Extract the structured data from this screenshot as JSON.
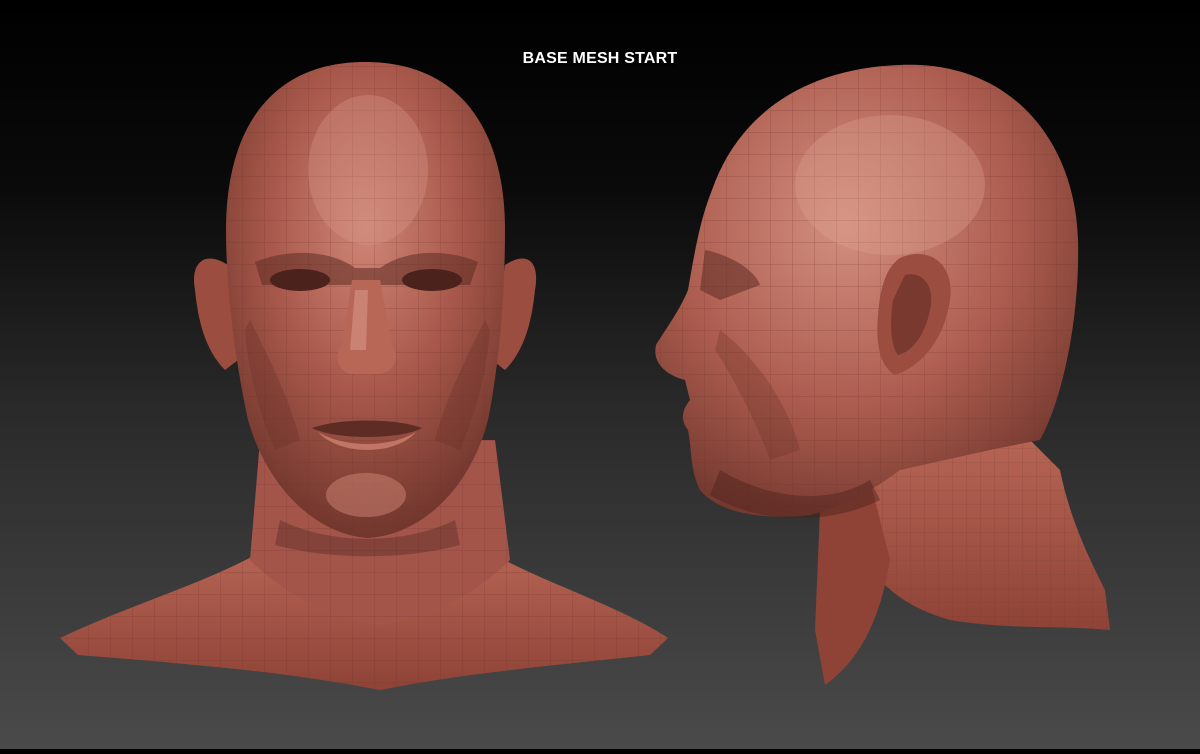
{
  "title": "BASE MESH START",
  "views": [
    {
      "name": "front-view"
    },
    {
      "name": "side-view"
    }
  ],
  "colors": {
    "skin_base": "#a8584a",
    "skin_light": "#d0897a",
    "skin_dark": "#5e2c24",
    "wire": "#6b3128"
  }
}
